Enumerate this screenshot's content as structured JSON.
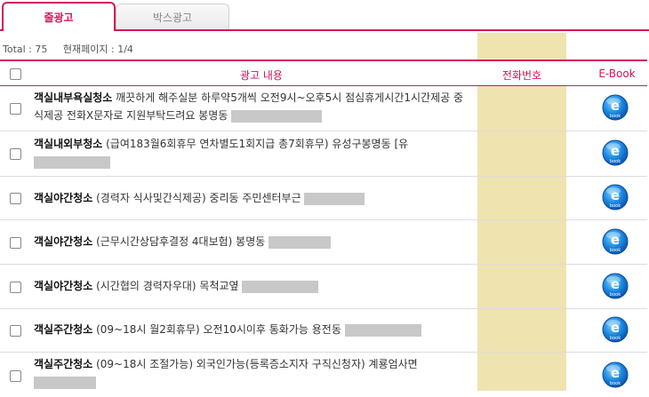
{
  "tabs": {
    "active": "줄광고",
    "inactive": "박스광고"
  },
  "info": {
    "total_label": "Total :",
    "total": "75",
    "page_label": "현재페이지 :",
    "page": "1/4"
  },
  "columns": {
    "ad": "광고 내용",
    "phone": "전화번호",
    "ebook": "E-Book"
  },
  "colors": {
    "accent": "#d4145a",
    "phone_bg": "#efe3b0"
  },
  "rows": [
    {
      "title": "객실내부욕실청소",
      "desc": " 깨끗하게 해주실분 하루약5개씩 오전9시~오후5시 점심휴게시간1시간제공 중식제공 전화X문자로 지원부탁드려요 봉명동"
    },
    {
      "title": "객실내외부청소",
      "desc": " (급여183월6회휴무 연차별도1회지급 총7회휴무) 유성구봉명동 [유"
    },
    {
      "title": "객실야간청소",
      "desc": " (경력자 식사및간식제공) 중리동 주민센터부근"
    },
    {
      "title": "객실야간청소",
      "desc": " (근무시간상담후결정 4대보험) 봉명동"
    },
    {
      "title": "객실야간청소",
      "desc": " (시간협의 경력자우대) 목척교옆"
    },
    {
      "title": "객실주간청소",
      "desc": " (09~18시 월2회휴무) 오전10시이후 통화가능 용전동"
    },
    {
      "title": "객실주간청소",
      "desc": " (09~18시 조절가능) 외국인가능(등록증소지자 구직신청자) 계룡엄사면"
    }
  ]
}
